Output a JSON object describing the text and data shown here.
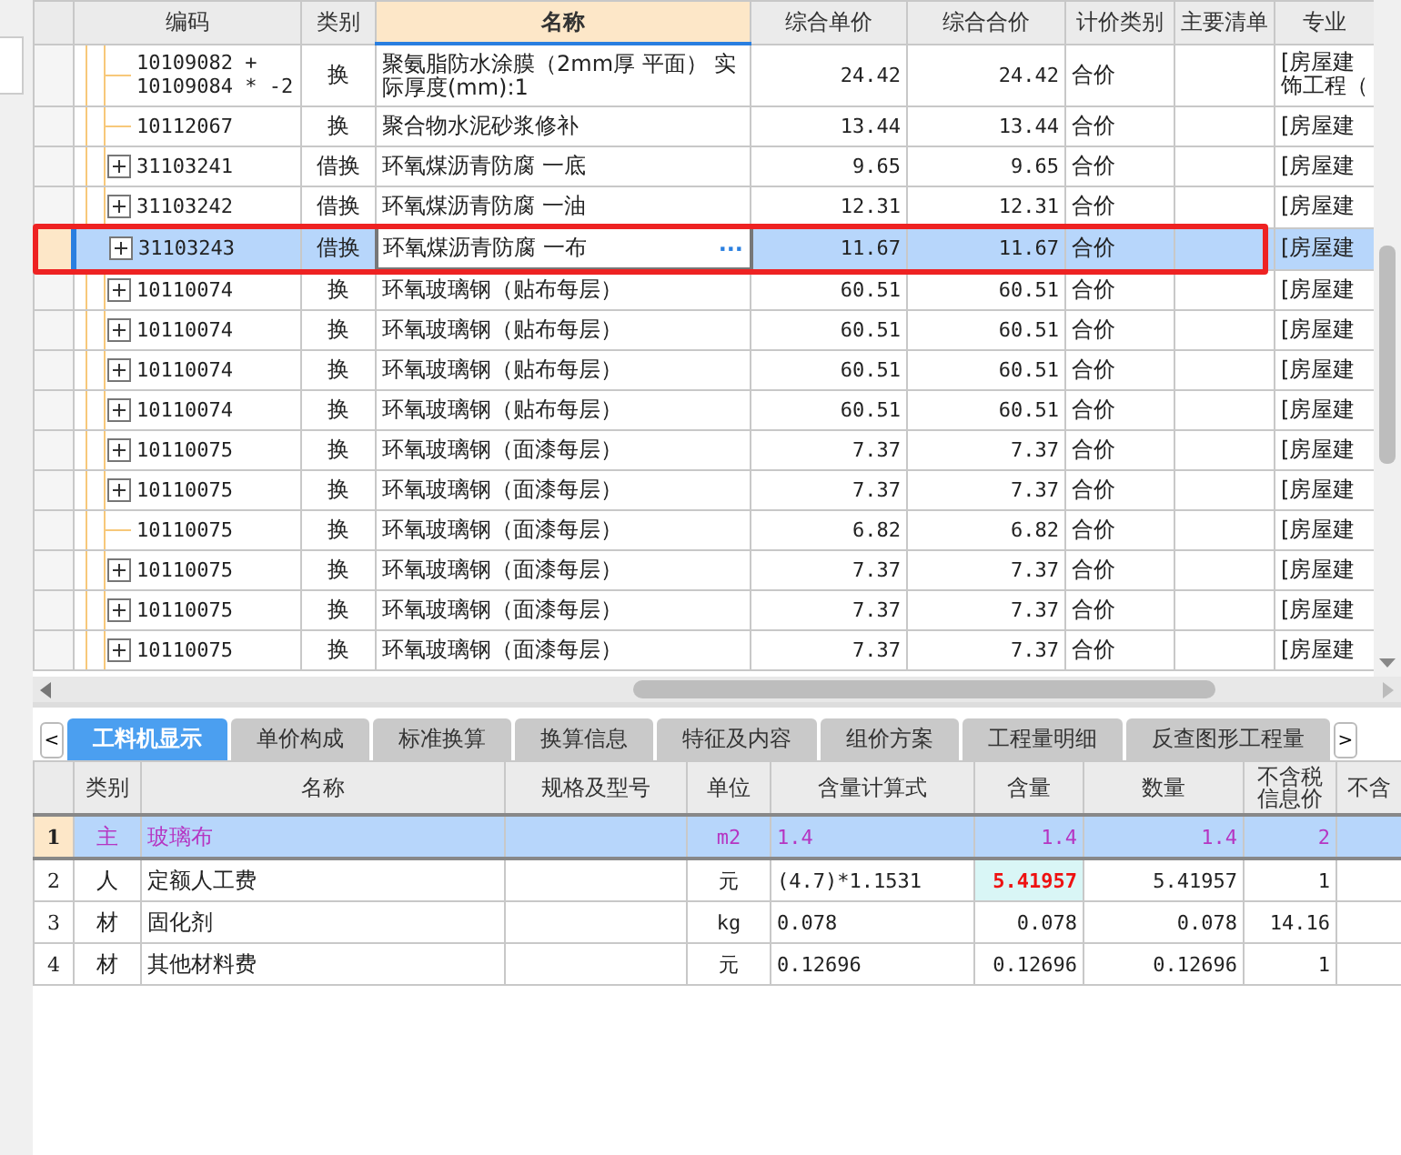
{
  "top_table": {
    "columns": [
      "编码",
      "类别",
      "名称",
      "综合单价",
      "综合合价",
      "计价类别",
      "主要清单",
      "专业"
    ],
    "rows": [
      {
        "kind": "leaf",
        "code": "10109082 + 10109084 * -2",
        "type": "换",
        "name": "聚氨脂防水涂膜（2mm厚 平面） 实际厚度(mm):1",
        "unit_price": "24.42",
        "total": "24.42",
        "pricing": "合价",
        "specialty": "[房屋建饰工程（",
        "selected": false
      },
      {
        "kind": "leaf",
        "code": "10112067",
        "type": "换",
        "name": "聚合物水泥砂浆修补",
        "unit_price": "13.44",
        "total": "13.44",
        "pricing": "合价",
        "specialty": "[房屋建",
        "selected": false
      },
      {
        "kind": "group",
        "code": "31103241",
        "type": "借换",
        "name": "环氧煤沥青防腐 一底",
        "unit_price": "9.65",
        "total": "9.65",
        "pricing": "合价",
        "specialty": "[房屋建",
        "selected": false
      },
      {
        "kind": "group",
        "code": "31103242",
        "type": "借换",
        "name": "环氧煤沥青防腐 一油",
        "unit_price": "12.31",
        "total": "12.31",
        "pricing": "合价",
        "specialty": "[房屋建",
        "selected": false
      },
      {
        "kind": "group",
        "code": "31103243",
        "type": "借换",
        "name": "环氧煤沥青防腐 一布",
        "action": "···",
        "unit_price": "11.67",
        "total": "11.67",
        "pricing": "合价",
        "specialty": "[房屋建",
        "selected": true
      },
      {
        "kind": "group",
        "code": "10110074",
        "type": "换",
        "name": "环氧玻璃钢（贴布每层）",
        "unit_price": "60.51",
        "total": "60.51",
        "pricing": "合价",
        "specialty": "[房屋建",
        "selected": false
      },
      {
        "kind": "group",
        "code": "10110074",
        "type": "换",
        "name": "环氧玻璃钢（贴布每层）",
        "unit_price": "60.51",
        "total": "60.51",
        "pricing": "合价",
        "specialty": "[房屋建",
        "selected": false
      },
      {
        "kind": "group",
        "code": "10110074",
        "type": "换",
        "name": "环氧玻璃钢（贴布每层）",
        "unit_price": "60.51",
        "total": "60.51",
        "pricing": "合价",
        "specialty": "[房屋建",
        "selected": false
      },
      {
        "kind": "group",
        "code": "10110074",
        "type": "换",
        "name": "环氧玻璃钢（贴布每层）",
        "unit_price": "60.51",
        "total": "60.51",
        "pricing": "合价",
        "specialty": "[房屋建",
        "selected": false
      },
      {
        "kind": "group",
        "code": "10110075",
        "type": "换",
        "name": "环氧玻璃钢（面漆每层）",
        "unit_price": "7.37",
        "total": "7.37",
        "pricing": "合价",
        "specialty": "[房屋建",
        "selected": false
      },
      {
        "kind": "group",
        "code": "10110075",
        "type": "换",
        "name": "环氧玻璃钢（面漆每层）",
        "unit_price": "7.37",
        "total": "7.37",
        "pricing": "合价",
        "specialty": "[房屋建",
        "selected": false
      },
      {
        "kind": "leaf",
        "code": "10110075",
        "type": "换",
        "name": "环氧玻璃钢（面漆每层）",
        "unit_price": "6.82",
        "total": "6.82",
        "pricing": "合价",
        "specialty": "[房屋建",
        "selected": false
      },
      {
        "kind": "group",
        "code": "10110075",
        "type": "换",
        "name": "环氧玻璃钢（面漆每层）",
        "unit_price": "7.37",
        "total": "7.37",
        "pricing": "合价",
        "specialty": "[房屋建",
        "selected": false
      },
      {
        "kind": "group",
        "code": "10110075",
        "type": "换",
        "name": "环氧玻璃钢（面漆每层）",
        "unit_price": "7.37",
        "total": "7.37",
        "pricing": "合价",
        "specialty": "[房屋建",
        "selected": false
      },
      {
        "kind": "group",
        "code": "10110075",
        "type": "换",
        "name": "环氧玻璃钢（面漆每层）",
        "unit_price": "7.37",
        "total": "7.37",
        "pricing": "合价",
        "specialty": "[房屋建",
        "selected": false
      }
    ]
  },
  "tabs_prev": "<",
  "tabs_next": ">",
  "tabs": [
    {
      "label": "工料机显示",
      "selected": true
    },
    {
      "label": "单价构成",
      "selected": false
    },
    {
      "label": "标准换算",
      "selected": false
    },
    {
      "label": "换算信息",
      "selected": false
    },
    {
      "label": "特征及内容",
      "selected": false
    },
    {
      "label": "组价方案",
      "selected": false
    },
    {
      "label": "工程量明细",
      "selected": false
    },
    {
      "label": "反查图形工程量",
      "selected": false
    }
  ],
  "bottom_table": {
    "columns": [
      "类别",
      "名称",
      "规格及型号",
      "单位",
      "含量计算式",
      "含量",
      "数量",
      "不含税信息价",
      "不含"
    ],
    "rows": [
      {
        "num": "1",
        "type": "主",
        "name": "玻璃布",
        "spec": "",
        "unit": "m2",
        "formula": "1.4",
        "content": "1.4",
        "qty": "1.4",
        "price": "2",
        "selected": true,
        "modified": false
      },
      {
        "num": "2",
        "type": "人",
        "name": "定额人工费",
        "spec": "",
        "unit": "元",
        "formula": "(4.7)*1.1531",
        "content": "5.41957",
        "qty": "5.41957",
        "price": "1",
        "selected": false,
        "modified": true
      },
      {
        "num": "3",
        "type": "材",
        "name": "固化剂",
        "spec": "",
        "unit": "kg",
        "formula": "0.078",
        "content": "0.078",
        "qty": "0.078",
        "price": "14.16",
        "selected": false,
        "modified": false
      },
      {
        "num": "4",
        "type": "材",
        "name": "其他材料费",
        "spec": "",
        "unit": "元",
        "formula": "0.12696",
        "content": "0.12696",
        "qty": "0.12696",
        "price": "1",
        "selected": false,
        "modified": false
      }
    ]
  }
}
